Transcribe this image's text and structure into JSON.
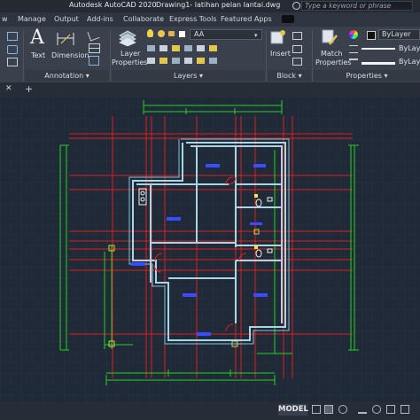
{
  "titlebar": {
    "app_title": "Autodesk AutoCAD 2020",
    "drawing_title": "Drawing1- latihan pelan lantai.dwg",
    "search_placeholder": "Type a keyword or phrase"
  },
  "menu_tabs": [
    "w",
    "Manage",
    "Output",
    "Add-ins",
    "Collaborate",
    "Express Tools",
    "Featured Apps"
  ],
  "ribbon": {
    "text_label": "Text",
    "dimension_label": "Dimension",
    "layer_properties_label_1": "Layer",
    "layer_properties_label_2": "Properties",
    "insert_label": "Insert",
    "match_properties_label_1": "Match",
    "match_properties_label_2": "Properties",
    "layer_dropdown_value": "AA",
    "color_value": "ByLayer",
    "linetype_value": "ByLayer",
    "lineweight_value": "ByLayer",
    "panels": {
      "annotation": "Annotation ▾",
      "layers": "Layers ▾",
      "block": "Block ▾",
      "properties": "Properties ▾"
    }
  },
  "doc_tabs": {
    "close_glyph": "✕",
    "add_glyph": "+"
  },
  "statusbar": {
    "model_label": "MODEL"
  },
  "colors": {
    "canvas_bg": "#1f2937",
    "wall": "#a9d6e5",
    "grid_red": "#e02020",
    "dim_green": "#22d422",
    "annot_yellow": "#e8e84a",
    "text_blue": "#3a4cff"
  }
}
